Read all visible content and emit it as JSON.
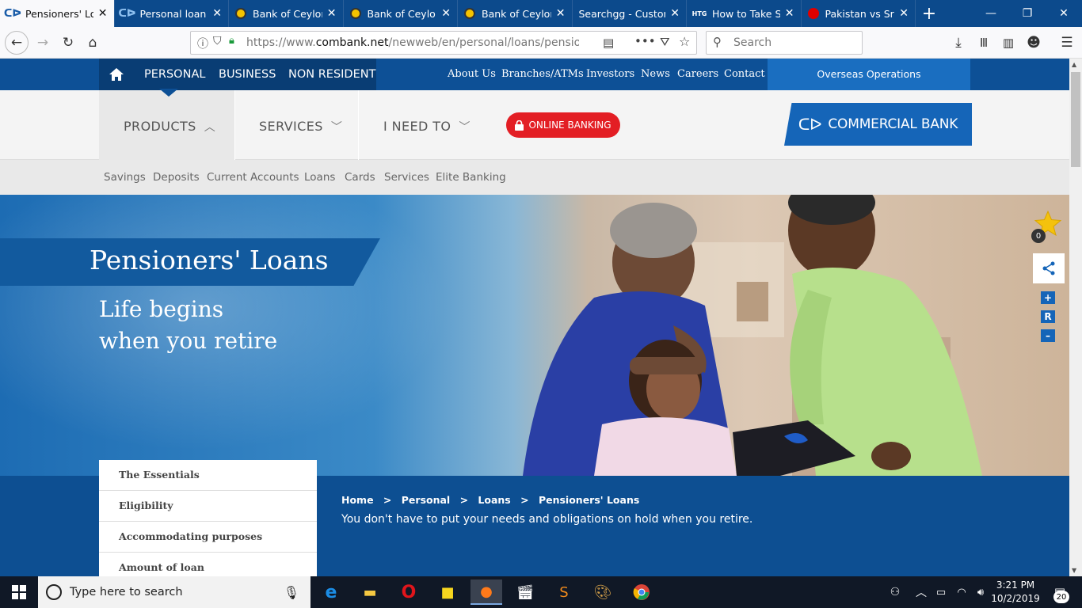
{
  "browser": {
    "tabs": [
      {
        "title": "Pensioners' Loans",
        "favicon": "commercial-bank",
        "active": true
      },
      {
        "title": "Personal loan | Pe",
        "favicon": "commercial-bank",
        "active": false
      },
      {
        "title": "Bank of Ceylon",
        "favicon": "boc",
        "active": false
      },
      {
        "title": "Bank of Ceylon",
        "favicon": "boc",
        "active": false
      },
      {
        "title": "Bank of Ceylon",
        "favicon": "boc",
        "active": false
      },
      {
        "title": "Searchgg - Custom",
        "favicon": "none",
        "active": false
      },
      {
        "title": "How to Take Scr",
        "favicon": "htg",
        "active": false
      },
      {
        "title": "Pakistan vs Sri Lan",
        "favicon": "pk",
        "active": false
      }
    ],
    "url_prefix": "https://www.",
    "url_domain": "combank.net",
    "url_path": "/newweb/en/personal/loans/pensioners-lo",
    "search_placeholder": "Search",
    "htg_label": "HTG"
  },
  "site": {
    "top_nav": [
      "PERSONAL",
      "BUSINESS",
      "NON RESIDENT"
    ],
    "util_links": [
      "About Us",
      "Branches/ATMs",
      "Investors",
      "News",
      "Careers",
      "Contact"
    ],
    "overseas": "Overseas Operations",
    "main_menu": {
      "products": "PRODUCTS",
      "services": "SERVICES",
      "ineed": "I NEED TO"
    },
    "online_banking": "ONLINE BANKING",
    "logo_text": "COMMERCIAL BANK",
    "sub_nav": [
      "Savings",
      "Deposits",
      "Current Accounts",
      "Loans",
      "Cards",
      "Services",
      "Elite Banking"
    ],
    "hero": {
      "title": "Pensioners' Loans",
      "tagline_1": "Life begins",
      "tagline_2": "when you retire"
    },
    "favourites_count": "0",
    "text_size_controls": [
      "+",
      "R",
      "–"
    ],
    "side_menu": [
      "The Essentials",
      "Eligibility",
      "Accommodating purposes",
      "Amount of loan"
    ],
    "breadcrumb": [
      "Home",
      ">",
      "Personal",
      ">",
      "Loans",
      ">",
      "Pensioners' Loans"
    ],
    "intro": "You don't have to put your needs and obligations on hold when you retire."
  },
  "taskbar": {
    "search_placeholder": "Type here to search",
    "time": "3:21 PM",
    "date": "10/2/2019",
    "notifications": "20"
  },
  "colors": {
    "brand_blue": "#0d5096",
    "accent_red": "#e31e24",
    "tab_bar": "#0c4a8c"
  }
}
